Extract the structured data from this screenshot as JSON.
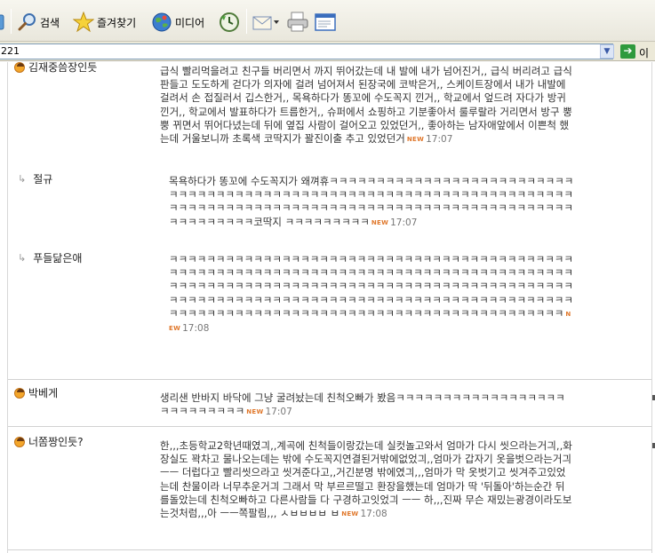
{
  "toolbar": {
    "search_label": "검색",
    "favorites_label": "즐겨찾기",
    "media_label": "미디어"
  },
  "address": {
    "value": "221",
    "go_label": "이동"
  },
  "comments": [
    {
      "author": "김재중씀장인듯",
      "text": "급식 빨리먹을려고 친구들 버리면서 까지 뛰어갔는데 내 발에 내가 넘어진거,, 급식 버리려고 급식판들고 도도하게 걷다가 의자에 걸려 넘어져서 된장국에 코박은거,, 스케이트장에서 내가 내발에 걸려서 손 접질러서 깁스한거,, 목욕하다가 똥꼬에 수도꼭지 낀거,, 학교에서 엎드려 자다가 방귀낀거,, 학교에서 발표하다가 트름한거,, 슈퍼에서 쇼핑하고 기분좋아서 룰루랄라 거리면서 방구 뿡뿡 뀌면서 뛰어다녔는데 뒤에 옆집 사람이 걸어오고 있었던거,, 좋아하는 남자애앞에서 이쁜척 했는데 거울보니까 초록색 코딱지가 꽐진이출 추고 있었던거",
      "new": "NEW",
      "time": "17:07"
    },
    {
      "author": "절규",
      "text": "목욕하다가 똥꼬에 수도꼭지가 왜껴휴ㅋㅋㅋㅋㅋㅋㅋㅋㅋㅋㅋㅋㅋㅋㅋㅋㅋㅋㅋㅋㅋㅋㅋㅋㅋㅋㅋㅋㅋㅋㅋㅋㅋㅋㅋㅋㅋㅋㅋㅋㅋㅋㅋㅋㅋㅋㅋㅋㅋㅋㅋㅋㅋㅋㅋㅋㅋㅋㅋㅋㅋㅋㅋㅋㅋㅋㅋㅋㅋㅋㅋㅋㅋㅋㅋㅋㅋㅋㅋㅋㅋㅋㅋㅋㅋㅋㅋㅋㅋㅋㅋㅋㅋㅋㅋㅋㅋㅋㅋㅋㅋㅋㅋㅋㅋㅋㅋㅋㅋㅋㅋㅋㅋㅋㅋㅋㅋㅋㅋㅋㅋ코딱지 ㅋㅋㅋㅋㅋㅋㅋㅋㅋ",
      "new": "NEW",
      "time": "17:07"
    },
    {
      "author": "푸들닮은애",
      "text": "ㅋㅋㅋㅋㅋㅋㅋㅋㅋㅋㅋㅋㅋㅋㅋㅋㅋㅋㅋㅋㅋㅋㅋㅋㅋㅋㅋㅋㅋㅋㅋㅋㅋㅋㅋㅋㅋㅋㅋㅋㅋㅋㅋㅋㅋㅋㅋㅋㅋㅋㅋㅋㅋㅋㅋㅋㅋㅋㅋㅋㅋㅋㅋㅋㅋㅋㅋㅋㅋㅋㅋㅋㅋㅋㅋㅋㅋㅋㅋㅋㅋㅋㅋㅋㅋㅋㅋㅋㅋㅋㅋㅋㅋㅋㅋㅋㅋㅋㅋㅋㅋㅋㅋㅋㅋㅋㅋㅋㅋㅋㅋㅋㅋㅋㅋㅋㅋㅋㅋㅋㅋㅋㅋㅋㅋㅋㅋㅋㅋㅋㅋㅋㅋㅋㅋㅋㅋㅋㅋㅋㅋㅋㅋㅋㅋㅋㅋㅋㅋㅋㅋㅋㅋㅋㅋㅋㅋㅋㅋㅋㅋㅋㅋㅋㅋㅋㅋㅋㅋㅋㅋㅋㅋㅋㅋㅋㅋㅋㅋㅋㅋㅋㅋㅋㅋㅋㅋㅋㅋㅋㅋㅋㅋㅋㅋㅋㅋㅋㅋㅋㅋㅋㅋㅋㅋㅋㅋㅋㅋㅋㅋㅋㅋㅋ",
      "new": "NEW",
      "time": "17:08"
    },
    {
      "author": "박베게",
      "text": "생리샌 반바지 바닥에 그냥 굴려놨는데 친척오빠가 봤음ㅋㅋㅋㅋㅋㅋㅋㅋㅋㅋㅋㅋㅋㅋㅋㅋㅋㅋㅋㅋㅋㅋㅋㅋㅋㅋㅋ",
      "new": "NEW",
      "time": "17:07"
    },
    {
      "author": "너쫌짱인듯?",
      "text": "한,,,초등학교2학년때였긔,,계곡에 친척들이랑갔는데 실컷놀고와서 엄마가 다시 씻으라는거긔,,화장실도 꽉차고 물나오는데는 밖에 수도꼭지연결된거밖에없었긔,,엄마가 갑자기 옷을벗으라는거긔 ㅡㅡ 더럽다고 빨리씻으라고 씻겨준다고,,거긴분명 밖에였긔,,,엄마가 막 옷벗기고 씻겨주고있었는데 찬물이라 너무추운거긔 그래서 막 부르르떨고 환장을했는데 엄마가 딱 '뒤돌아'하는순간 뒤를돌았는데 친척오빠하고 다른사람들 다 구경하고잇었긔 ㅡㅡ 하,,,진짜 무슨 재밌는광경이라도보는것처럼,,,아 ㅡㅡ쪽팔림,,, ㅅㅂㅂㅂㅂ ㅂ",
      "new": "NEW",
      "time": "17:08"
    }
  ]
}
